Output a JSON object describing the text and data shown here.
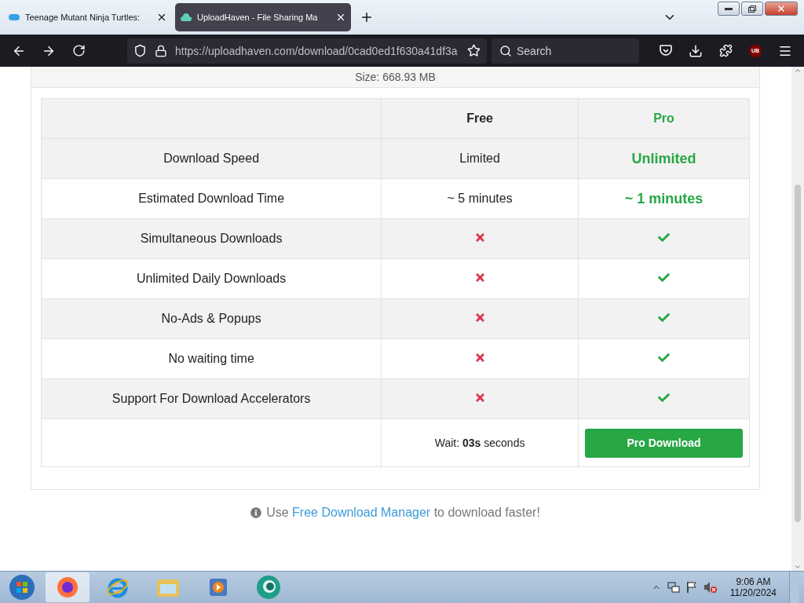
{
  "browser": {
    "tabs": [
      {
        "title": "Teenage Mutant Ninja Turtles:",
        "selected": false
      },
      {
        "title": "UploadHaven - File Sharing Ma",
        "selected": true
      }
    ],
    "url": "https://uploadhaven.com/download/0cad0ed1f630a41df3a",
    "search": {
      "placeholder": "Search"
    },
    "extension_badge": "UB"
  },
  "page": {
    "size": "Size: 668.93 MB",
    "table": {
      "columns": {
        "free": "Free",
        "pro": "Pro"
      },
      "rows": [
        {
          "feature": "Download Speed",
          "free": {
            "kind": "text",
            "text": "Limited"
          },
          "pro": {
            "kind": "text",
            "text": "Unlimited"
          }
        },
        {
          "feature": "Estimated Download Time",
          "free": {
            "kind": "text",
            "text": "~ 5 minutes"
          },
          "pro": {
            "kind": "text",
            "text": "~ 1 minutes"
          }
        },
        {
          "feature": "Simultaneous Downloads",
          "free": {
            "kind": "mark",
            "available": false
          },
          "pro": {
            "kind": "mark",
            "available": true
          }
        },
        {
          "feature": "Unlimited Daily Downloads",
          "free": {
            "kind": "mark",
            "available": false
          },
          "pro": {
            "kind": "mark",
            "available": true
          }
        },
        {
          "feature": "No-Ads & Popups",
          "free": {
            "kind": "mark",
            "available": false
          },
          "pro": {
            "kind": "mark",
            "available": true
          }
        },
        {
          "feature": "No waiting time",
          "free": {
            "kind": "mark",
            "available": false
          },
          "pro": {
            "kind": "mark",
            "available": true
          }
        },
        {
          "feature": "Support For Download Accelerators",
          "free": {
            "kind": "mark",
            "available": false
          },
          "pro": {
            "kind": "mark",
            "available": true
          }
        }
      ],
      "wait": "Wait: **03s** seconds",
      "button": "Pro Download"
    },
    "note": {
      "before": "Use",
      "link": "Free Download Manager",
      "after": "to download faster!"
    }
  },
  "taskbar": {
    "time": "9:06 AM",
    "date": "11/20/2024"
  }
}
